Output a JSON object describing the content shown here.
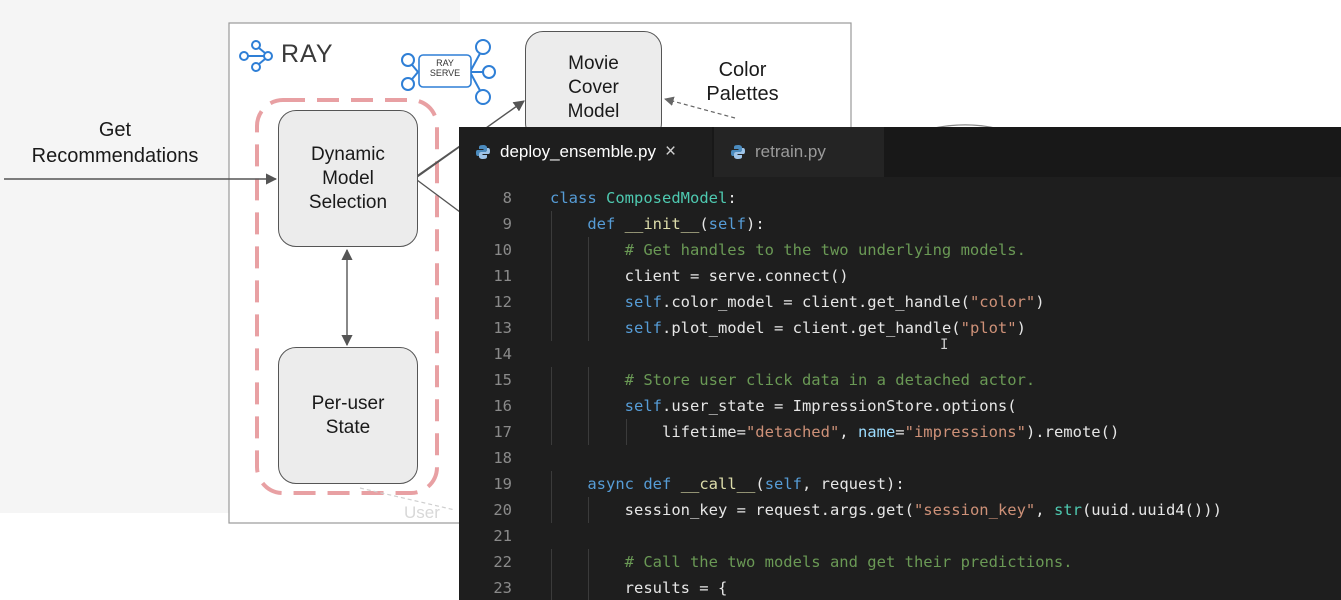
{
  "diagram": {
    "ray_logo": "RAY",
    "ray_serve_badge": "RAY\nSERVE",
    "input_label": "Get\nRecommendations",
    "nodes": {
      "dynamic": "Dynamic\nModel\nSelection",
      "per_user": "Per-user\nState",
      "movie_cover": "Movie\nCover\nModel"
    },
    "color_palettes": "Color\nPalettes",
    "faded_label": "User"
  },
  "editor": {
    "tabs": [
      {
        "label": "deploy_ensemble.py",
        "active": true,
        "close_icon": "×"
      },
      {
        "label": "retrain.py",
        "active": false
      }
    ],
    "lines": [
      {
        "n": "8",
        "text": "class ComposedModel:"
      },
      {
        "n": "9",
        "text": "    def __init__(self):"
      },
      {
        "n": "10",
        "text": "        # Get handles to the two underlying models."
      },
      {
        "n": "11",
        "text": "        client = serve.connect()"
      },
      {
        "n": "12",
        "text": "        self.color_model = client.get_handle(\"color\")"
      },
      {
        "n": "13",
        "text": "        self.plot_model = client.get_handle(\"plot\")"
      },
      {
        "n": "14",
        "text": ""
      },
      {
        "n": "15",
        "text": "        # Store user click data in a detached actor."
      },
      {
        "n": "16",
        "text": "        self.user_state = ImpressionStore.options("
      },
      {
        "n": "17",
        "text": "            lifetime=\"detached\", name=\"impressions\").remote()"
      },
      {
        "n": "18",
        "text": ""
      },
      {
        "n": "19",
        "text": "    async def __call__(self, request):"
      },
      {
        "n": "20",
        "text": "        session_key = request.args.get(\"session_key\", str(uuid.uuid4()))"
      },
      {
        "n": "21",
        "text": ""
      },
      {
        "n": "22",
        "text": "        # Call the two models and get their predictions."
      },
      {
        "n": "23",
        "text": "        results = {"
      }
    ],
    "colors": {
      "background": "#1e1e1e",
      "keyword": "#569cd6",
      "class_name": "#4ec9b0",
      "function": "#dcdcaa",
      "string": "#ce9178",
      "comment": "#6a9955",
      "parameter": "#9cdcfe"
    }
  }
}
